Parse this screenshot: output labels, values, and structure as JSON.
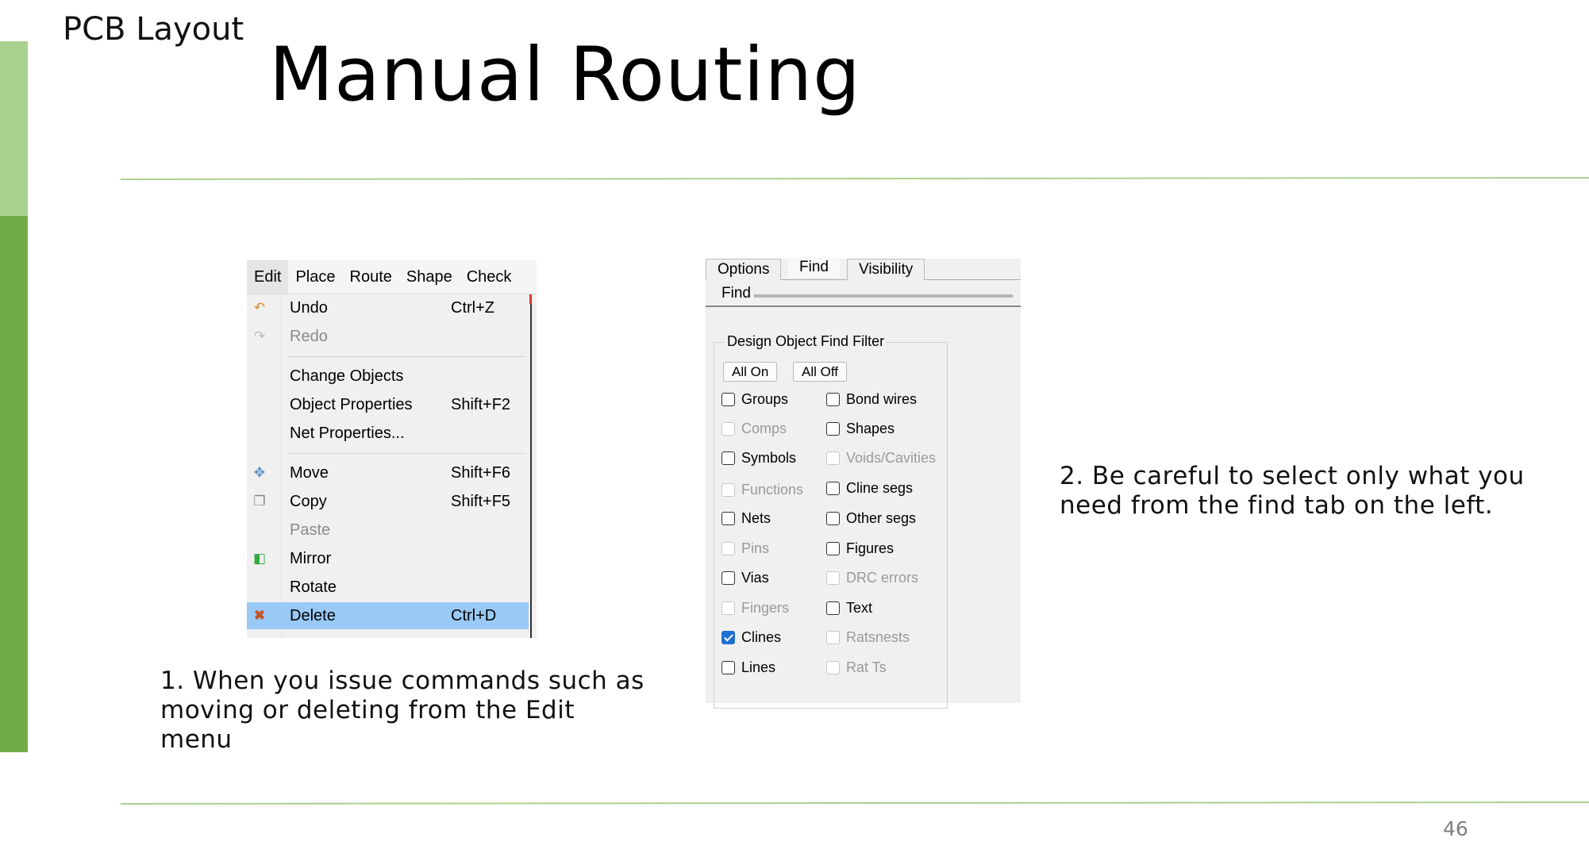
{
  "slide": {
    "section_label": "PCB Layout",
    "title": "Manual Routing",
    "page_number": "46",
    "caption_1": "1. When you issue commands such as moving or deleting from the Edit menu",
    "caption_2": "2. Be careful to select only what you need from the find tab on the left.",
    "accent_colors": {
      "light": "#a9d18e",
      "dark": "#70ad47"
    }
  },
  "edit_menu": {
    "menubar": [
      "Edit",
      "Place",
      "Route",
      "Shape",
      "Check"
    ],
    "items": [
      {
        "icon": "undo-icon",
        "label": "Undo",
        "shortcut": "Ctrl+Z",
        "enabled": true
      },
      {
        "icon": "redo-icon",
        "label": "Redo",
        "shortcut": "",
        "enabled": false
      },
      {
        "icon": "",
        "label": "Change Objects",
        "shortcut": "",
        "enabled": true
      },
      {
        "icon": "",
        "label": "Object Properties",
        "shortcut": "Shift+F2",
        "enabled": true
      },
      {
        "icon": "",
        "label": "Net Properties...",
        "shortcut": "",
        "enabled": true
      },
      {
        "icon": "move-icon",
        "label": "Move",
        "shortcut": "Shift+F6",
        "enabled": true
      },
      {
        "icon": "copy-icon",
        "label": "Copy",
        "shortcut": "Shift+F5",
        "enabled": true
      },
      {
        "icon": "",
        "label": "Paste",
        "shortcut": "",
        "enabled": false
      },
      {
        "icon": "mirror-icon",
        "label": "Mirror",
        "shortcut": "",
        "enabled": true
      },
      {
        "icon": "",
        "label": "Rotate",
        "shortcut": "",
        "enabled": true
      },
      {
        "icon": "delete-icon",
        "label": "Delete",
        "shortcut": "Ctrl+D",
        "enabled": true,
        "highlighted": true
      }
    ]
  },
  "find_panel": {
    "tabs": [
      "Options",
      "Find",
      "Visibility"
    ],
    "selected_tab": "Find",
    "header_label": "Find",
    "group_title": "Design Object Find Filter",
    "buttons": [
      "All On",
      "All Off"
    ],
    "left_column": [
      {
        "label": "Groups",
        "checked": false,
        "enabled": true
      },
      {
        "label": "Comps",
        "checked": false,
        "enabled": false
      },
      {
        "label": "Symbols",
        "checked": false,
        "enabled": true
      },
      {
        "label": "Functions",
        "checked": false,
        "enabled": false
      },
      {
        "label": "Nets",
        "checked": false,
        "enabled": true
      },
      {
        "label": "Pins",
        "checked": false,
        "enabled": false
      },
      {
        "label": "Vias",
        "checked": false,
        "enabled": true
      },
      {
        "label": "Fingers",
        "checked": false,
        "enabled": false
      },
      {
        "label": "Clines",
        "checked": true,
        "enabled": true
      },
      {
        "label": "Lines",
        "checked": false,
        "enabled": true
      }
    ],
    "right_column": [
      {
        "label": "Bond wires",
        "checked": false,
        "enabled": true
      },
      {
        "label": "Shapes",
        "checked": false,
        "enabled": true
      },
      {
        "label": "Voids/Cavities",
        "checked": false,
        "enabled": false
      },
      {
        "label": "Cline segs",
        "checked": false,
        "enabled": true
      },
      {
        "label": "Other segs",
        "checked": false,
        "enabled": true
      },
      {
        "label": "Figures",
        "checked": false,
        "enabled": true
      },
      {
        "label": "DRC errors",
        "checked": false,
        "enabled": false
      },
      {
        "label": "Text",
        "checked": false,
        "enabled": true
      },
      {
        "label": "Ratsnests",
        "checked": false,
        "enabled": false
      },
      {
        "label": "Rat Ts",
        "checked": false,
        "enabled": false
      }
    ]
  }
}
